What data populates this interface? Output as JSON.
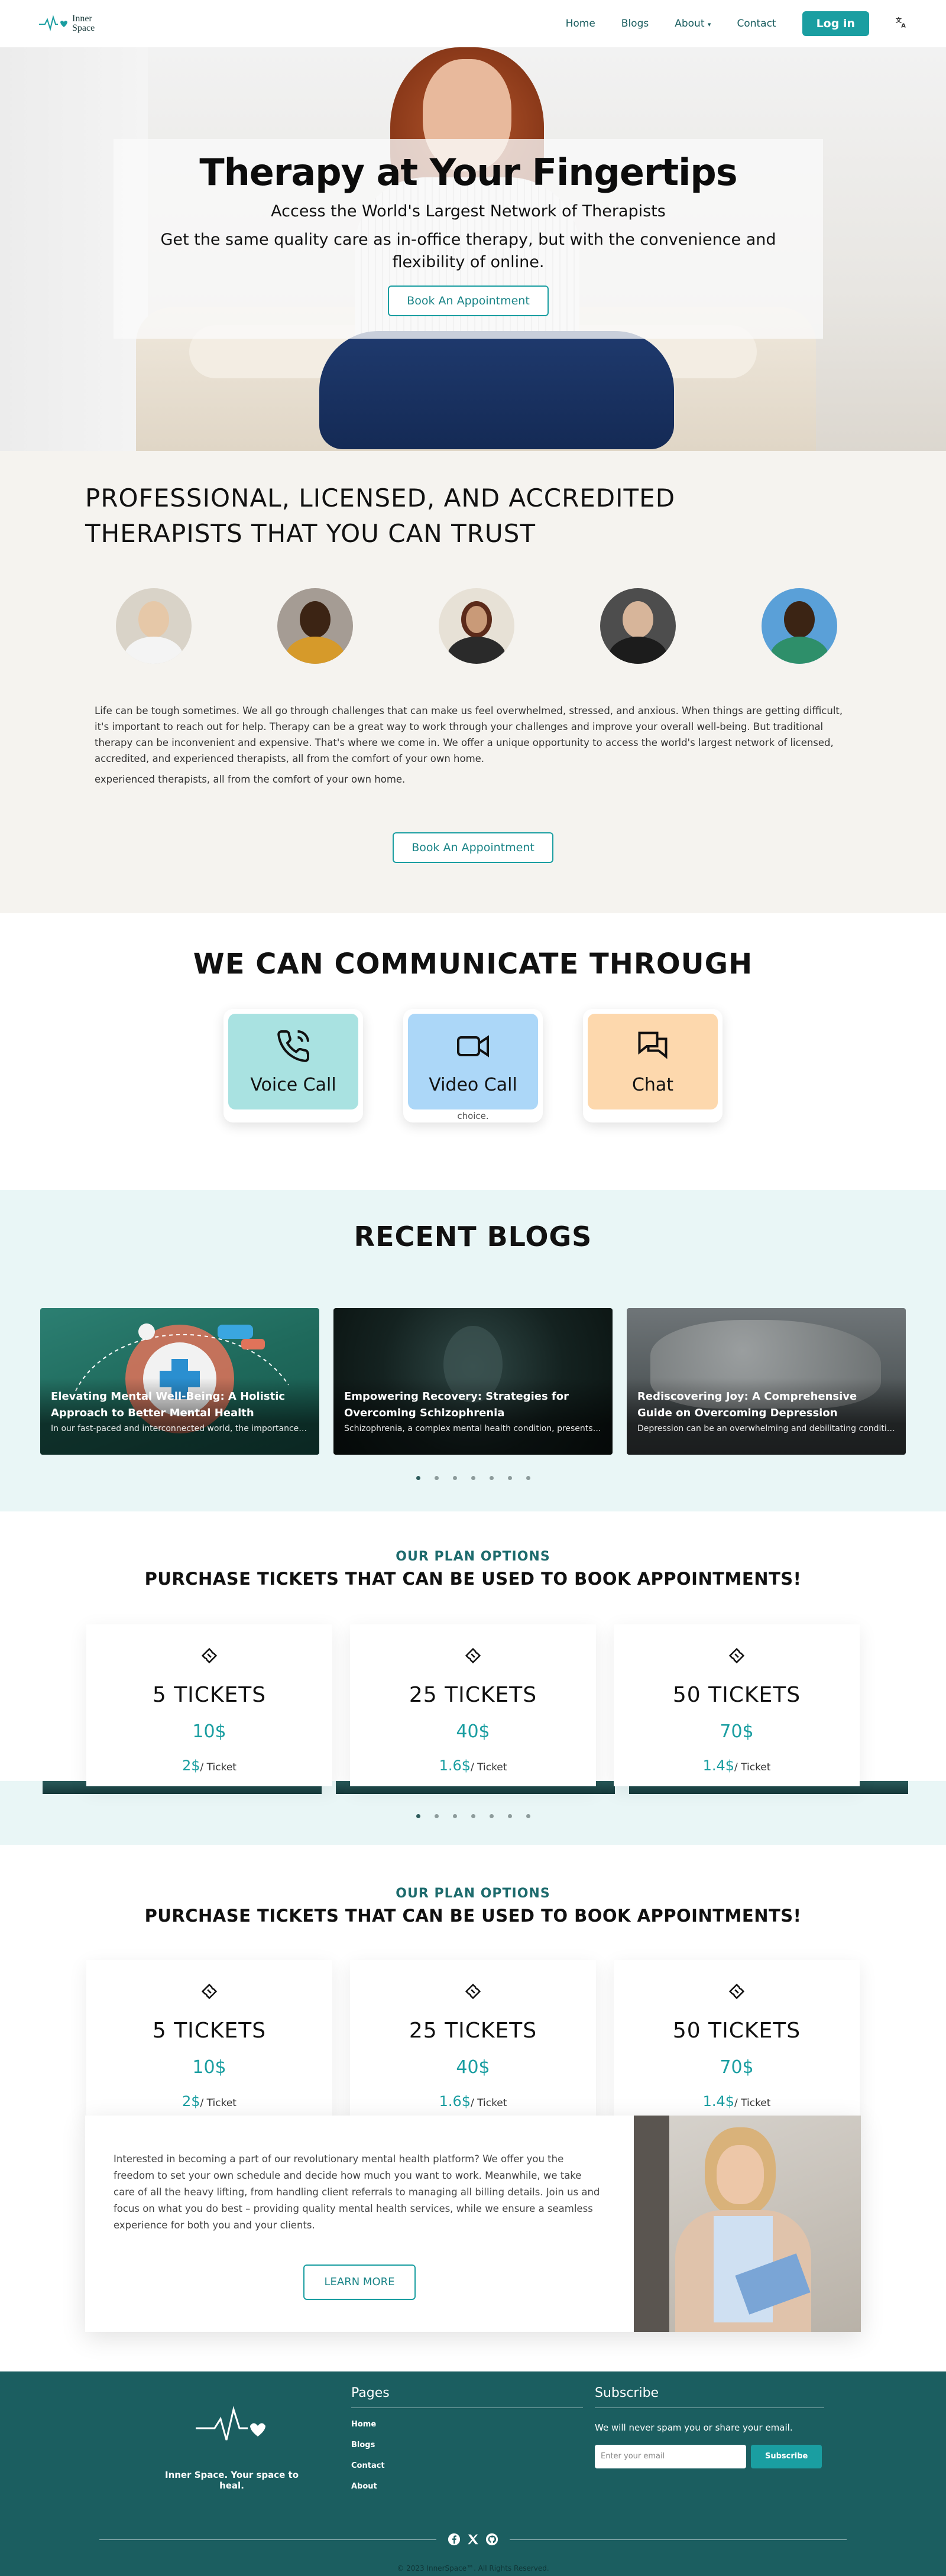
{
  "nav": {
    "brand_line1": "Inner",
    "brand_line2": "Space",
    "links": [
      "Home",
      "Blogs",
      "About",
      "Contact"
    ],
    "about_caret": "▾",
    "login": "Log in",
    "translate_icon": "translate-icon"
  },
  "hero": {
    "title": "Therapy at Your Fingertips",
    "subtitle": "Access the World's Largest Network of Therapists",
    "description": "Get the same quality care as in-office therapy, but with the convenience and flexibility of online.",
    "cta": "Book An Appointment"
  },
  "therapists": {
    "title_line1": "PROFESSIONAL, LICENSED, AND ACCREDITED",
    "title_line2": "THERAPISTS THAT YOU CAN TRUST",
    "paragraph": "Life can be tough sometimes. We all go through challenges that can make us feel overwhelmed, stressed, and anxious. When things are getting difficult, it's important to reach out for help. Therapy can be a great way to work through your challenges and improve your overall well-being. But traditional therapy can be inconvenient and expensive. That's where we come in. We offer a unique opportunity to access the world's largest network of licensed, accredited, and experienced therapists, all from the comfort of your own home.",
    "paragraph_repeat": "experienced therapists, all from the comfort of your own home.",
    "cta": "Book An Appointment"
  },
  "communicate": {
    "title": "WE CAN COMMUNICATE THROUGH",
    "channels": [
      {
        "label": "Voice Call",
        "icon": "phone-icon",
        "color": "#a9e2e1"
      },
      {
        "label": "Video Call",
        "icon": "video-icon",
        "color": "#acd7f8"
      },
      {
        "label": "Chat",
        "icon": "chat-icon",
        "color": "#fdd8ad"
      }
    ],
    "note": "choice."
  },
  "blogs": {
    "title": "RECENT BLOGS",
    "posts": [
      {
        "title": "Elevating Mental Well-Being: A Holistic Approach to Better Mental Health",
        "excerpt": "In our fast-paced and interconnected world, the importance of ment..."
      },
      {
        "title": "Empowering Recovery: Strategies for Overcoming Schizophrenia",
        "excerpt": "Schizophrenia, a complex mental health condition, presents unique..."
      },
      {
        "title": "Rediscovering Joy: A Comprehensive Guide on Overcoming Depression",
        "excerpt": "Depression can be an overwhelming and debilitating condition that..."
      }
    ],
    "dots_count": 7
  },
  "plans": {
    "kicker": "OUR PLAN OPTIONS",
    "title": "PURCHASE TICKETS THAT CAN BE USED TO BOOK APPOINTMENTS!",
    "options": [
      {
        "name": "5 TICKETS",
        "price": "10$",
        "per_value": "2$",
        "per_unit": "/ Ticket"
      },
      {
        "name": "25 TICKETS",
        "price": "40$",
        "per_value": "1.6$",
        "per_unit": "/ Ticket"
      },
      {
        "name": "50 TICKETS",
        "price": "70$",
        "per_value": "1.4$",
        "per_unit": "/ Ticket"
      }
    ]
  },
  "join": {
    "text": "Interested in becoming a part of our revolutionary mental health platform? We offer you the freedom to set your own schedule and decide how much you want to work. Meanwhile, we take care of all the heavy lifting, from handling client referrals to managing all billing details. Join us and focus on what you do best – providing quality mental health services, while we ensure a seamless experience for both you and your clients.",
    "cta": "LEARN MORE"
  },
  "footer": {
    "tagline": "Inner Space. Your space to heal.",
    "pages_title": "Pages",
    "pages": [
      "Home",
      "Blogs",
      "Contact",
      "About"
    ],
    "subscribe_title": "Subscribe",
    "subscribe_text": "We will never spam you or share your email.",
    "email_placeholder": "Enter your email",
    "subscribe_button": "Subscribe",
    "copyright": "© 2023 InnerSpace™. All Rights Reserved."
  },
  "colors": {
    "accent": "#1a9ea1",
    "footer": "#1b5e60",
    "light_section": "#e9f6f6",
    "beige_section": "#f5f3ef"
  }
}
